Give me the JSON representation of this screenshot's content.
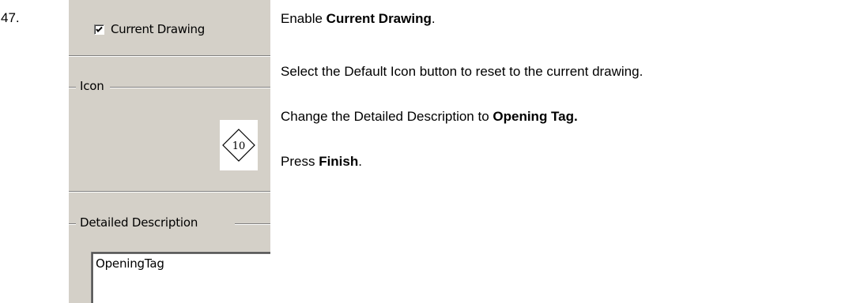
{
  "step_number": "47.",
  "dialog": {
    "checkbox": {
      "label": "Current Drawing",
      "checked": true
    },
    "icon_group": {
      "title": "Icon",
      "icon_name": "diamond-tag-icon",
      "icon_text": "10"
    },
    "description_group": {
      "title": "Detailed Description",
      "value": "OpeningTag"
    }
  },
  "instructions": [
    {
      "before": "Enable ",
      "bold": "Current Drawing",
      "after": "."
    },
    {
      "before": "Select the Default Icon button to reset to the current drawing.",
      "bold": "",
      "after": ""
    },
    {
      "before": "Change the Detailed Description to ",
      "bold": "Opening Tag.",
      "after": ""
    },
    {
      "before": "Press ",
      "bold": "Finish",
      "after": "."
    }
  ]
}
